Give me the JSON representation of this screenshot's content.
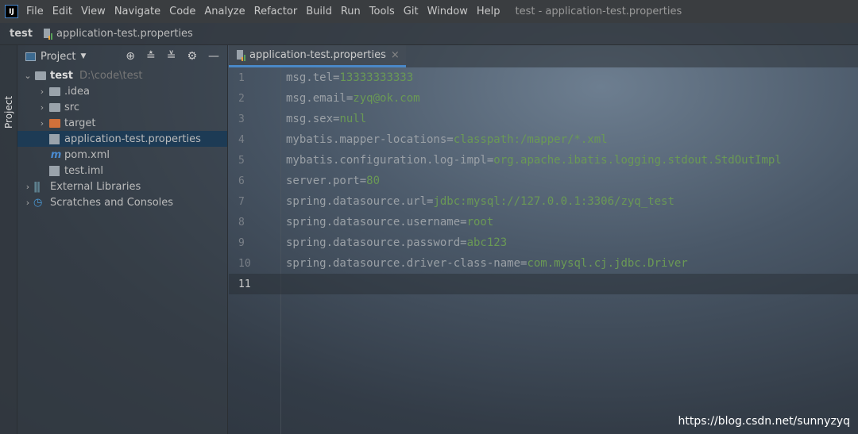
{
  "menubar": {
    "logo": "IJ",
    "items": [
      "File",
      "Edit",
      "View",
      "Navigate",
      "Code",
      "Analyze",
      "Refactor",
      "Build",
      "Run",
      "Tools",
      "Git",
      "Window",
      "Help"
    ],
    "title": "test - application-test.properties"
  },
  "breadcrumb": {
    "project": "test",
    "file": "application-test.properties"
  },
  "stripe": {
    "label": "Project"
  },
  "panel": {
    "title": "Project",
    "tree": [
      {
        "label": "test",
        "hint": "D:\\code\\test",
        "icon": "folder-module-icon",
        "level": 0,
        "chev": "⌄"
      },
      {
        "label": ".idea",
        "icon": "folder-icon",
        "level": 1,
        "chev": "›"
      },
      {
        "label": "src",
        "icon": "folder-icon",
        "level": 1,
        "chev": "›"
      },
      {
        "label": "target",
        "icon": "folder-excluded-icon",
        "level": 1,
        "chev": "›"
      },
      {
        "label": "application-test.properties",
        "icon": "properties-file-icon",
        "level": 1,
        "selected": true
      },
      {
        "label": "pom.xml",
        "icon": "maven-icon",
        "level": 1
      },
      {
        "label": "test.iml",
        "icon": "iml-file-icon",
        "level": 1
      },
      {
        "label": "External Libraries",
        "icon": "libraries-icon",
        "level": 0,
        "chev": "›"
      },
      {
        "label": "Scratches and Consoles",
        "icon": "scratches-icon",
        "level": 0,
        "chev": "›"
      }
    ]
  },
  "editor": {
    "tab": "application-test.properties",
    "lines": [
      {
        "n": "1",
        "k": "msg.tel=",
        "v": "13333333333"
      },
      {
        "n": "2",
        "k": "msg.email=",
        "v": "zyq@ok.com"
      },
      {
        "n": "3",
        "k": "msg.sex=",
        "v": "null"
      },
      {
        "n": "4",
        "k": "mybatis.mapper-locations=",
        "v": "classpath:/mapper/*.xml"
      },
      {
        "n": "5",
        "k": "mybatis.configuration.log-impl=",
        "v": "org.apache.ibatis.logging.stdout.StdOutImpl"
      },
      {
        "n": "6",
        "k": "server.port=",
        "v": "80"
      },
      {
        "n": "7",
        "k": "spring.datasource.url=",
        "v": "jdbc:mysql://127.0.0.1:3306/zyq_test"
      },
      {
        "n": "8",
        "k": "spring.datasource.username=",
        "v": "root"
      },
      {
        "n": "9",
        "k": "spring.datasource.password=",
        "v": "abc123"
      },
      {
        "n": "10",
        "k": "spring.datasource.driver-class-name=",
        "v": "com.mysql.cj.jdbc.Driver"
      },
      {
        "n": "11",
        "k": "",
        "v": ""
      }
    ]
  },
  "watermark": "https://blog.csdn.net/sunnyzyq"
}
